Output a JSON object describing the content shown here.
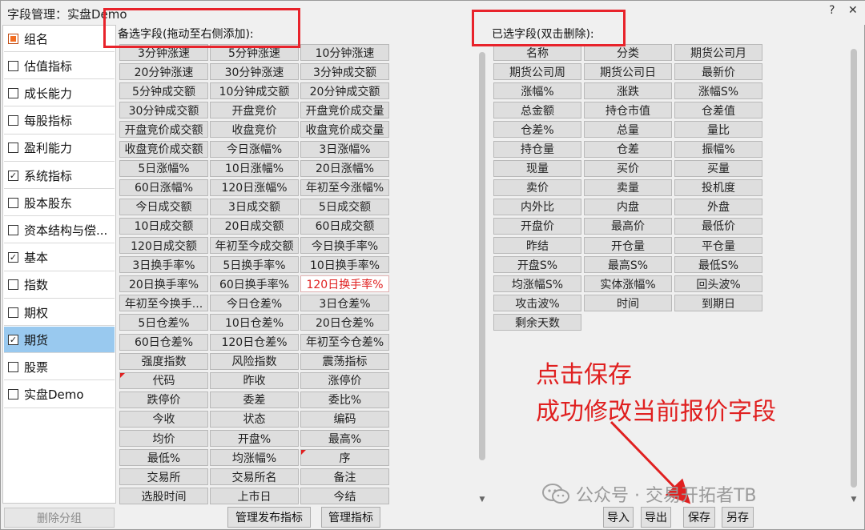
{
  "window": {
    "title": "字段管理：实盘Demo",
    "help_label": "?",
    "close_label": "✕"
  },
  "groups": [
    {
      "label": "组名",
      "state": "header"
    },
    {
      "label": "估值指标",
      "state": "unchecked"
    },
    {
      "label": "成长能力",
      "state": "unchecked"
    },
    {
      "label": "每股指标",
      "state": "unchecked"
    },
    {
      "label": "盈利能力",
      "state": "unchecked"
    },
    {
      "label": "系统指标",
      "state": "checked"
    },
    {
      "label": "股本股东",
      "state": "unchecked"
    },
    {
      "label": "资本结构与偿...",
      "state": "unchecked"
    },
    {
      "label": "基本",
      "state": "checked"
    },
    {
      "label": "指数",
      "state": "unchecked"
    },
    {
      "label": "期权",
      "state": "unchecked"
    },
    {
      "label": "期货",
      "state": "checked",
      "selected": true
    },
    {
      "label": "股票",
      "state": "unchecked"
    },
    {
      "label": "实盘Demo",
      "state": "unchecked"
    }
  ],
  "delete_group_label": "删除分组",
  "candidate": {
    "label": "备选字段(拖动至右侧添加):",
    "fields": [
      "3分钟涨速",
      "5分钟涨速",
      "10分钟涨速",
      "20分钟涨速",
      "30分钟涨速",
      "3分钟成交额",
      "5分钟成交额",
      "10分钟成交额",
      "20分钟成交额",
      "30分钟成交额",
      "开盘竞价",
      "开盘竞价成交量",
      "开盘竞价成交额",
      "收盘竞价",
      "收盘竞价成交量",
      "收盘竞价成交额",
      "今日涨幅%",
      "3日涨幅%",
      "5日涨幅%",
      "10日涨幅%",
      "20日涨幅%",
      "60日涨幅%",
      "120日涨幅%",
      "年初至今涨幅%",
      "今日成交额",
      "3日成交额",
      "5日成交额",
      "10日成交额",
      "20日成交额",
      "60日成交额",
      "120日成交额",
      "年初至今成交额",
      "今日换手率%",
      "3日换手率%",
      "5日换手率%",
      "10日换手率%",
      "20日换手率%",
      "60日换手率%",
      "120日换手率%",
      "年初至今换手...",
      "今日仓差%",
      "3日仓差%",
      "5日仓差%",
      "10日仓差%",
      "20日仓差%",
      "60日仓差%",
      "120日仓差%",
      "年初至今仓差%",
      "强度指数",
      "风险指数",
      "震荡指标",
      "代码",
      "昨收",
      "涨停价",
      "跌停价",
      "委差",
      "委比%",
      "今收",
      "状态",
      "编码",
      "均价",
      "开盘%",
      "最高%",
      "最低%",
      "均涨幅%",
      "序",
      "交易所",
      "交易所名",
      "备注",
      "选股时间",
      "上市日",
      "今结"
    ],
    "highlighted_field": "120日换手率%",
    "marked_fields": [
      "代码",
      "序"
    ]
  },
  "bottom_buttons": {
    "manage_publish": "管理发布指标",
    "manage": "管理指标",
    "import": "导入",
    "export": "导出",
    "save": "保存",
    "save_as": "另存"
  },
  "selected": {
    "label": "已选字段(双击删除):",
    "fields": [
      "名称",
      "分类",
      "期货公司月",
      "期货公司周",
      "期货公司日",
      "最新价",
      "涨幅%",
      "涨跌",
      "涨幅S%",
      "总金额",
      "持仓市值",
      "仓差值",
      "仓差%",
      "总量",
      "量比",
      "持仓量",
      "仓差",
      "振幅%",
      "现量",
      "买价",
      "买量",
      "卖价",
      "卖量",
      "投机度",
      "内外比",
      "内盘",
      "外盘",
      "开盘价",
      "最高价",
      "最低价",
      "昨结",
      "开仓量",
      "平仓量",
      "开盘S%",
      "最高S%",
      "最低S%",
      "均涨幅S%",
      "实体涨幅%",
      "回头波%",
      "攻击波%",
      "时间",
      "到期日",
      "剩余天数"
    ]
  },
  "annotation": {
    "line1": "点击保存",
    "line2": "成功修改当前报价字段"
  },
  "watermark": "公众号 · 交易开拓者TB",
  "colors": {
    "annotation_red": "#e02020",
    "selected_row": "#99c9ef",
    "header_checkbox": "#f26d21"
  }
}
